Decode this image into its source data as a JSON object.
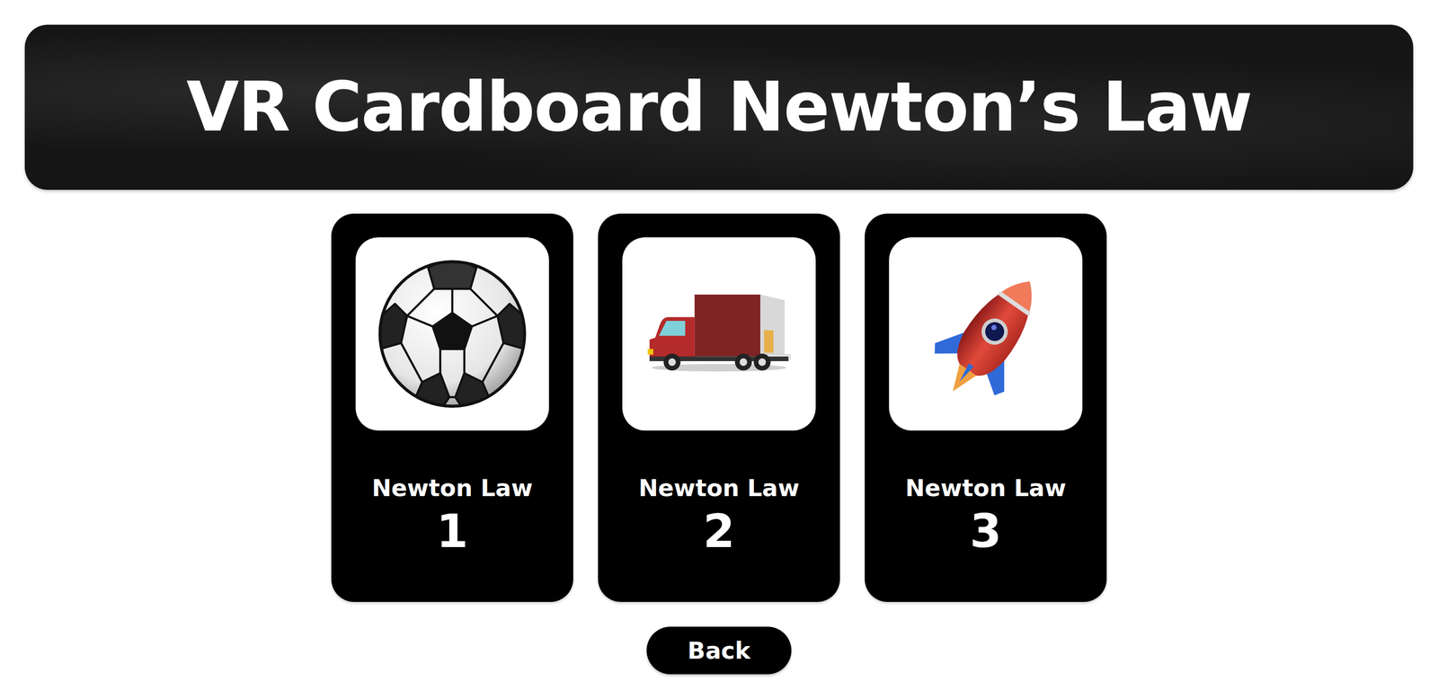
{
  "title": "VR Cardboard Newton’s Law",
  "cards": [
    {
      "label": "Newton Law",
      "number": "1"
    },
    {
      "label": "Newton Law",
      "number": "2"
    },
    {
      "label": "Newton Law",
      "number": "3"
    }
  ],
  "back_button": "Back"
}
